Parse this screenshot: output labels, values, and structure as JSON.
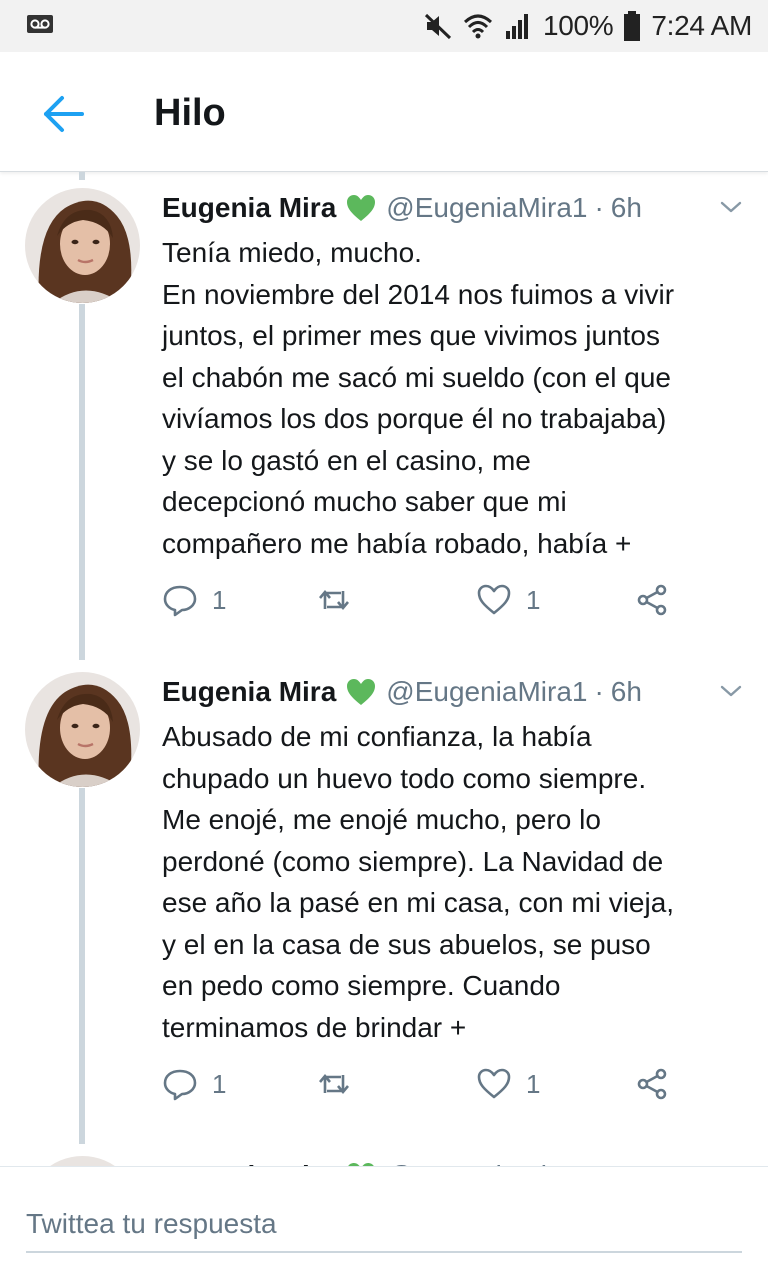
{
  "statusbar": {
    "battery": "100%",
    "time": "7:24 AM"
  },
  "header": {
    "title": "Hilo"
  },
  "tweets": [
    {
      "name": "Eugenia Mira",
      "handle": "@EugeniaMira1",
      "separator": "·",
      "time": "6h",
      "lines": [
        "Tenía miedo, mucho.",
        "En noviembre del 2014 nos fuimos a vivir",
        "juntos, el primer mes que vivimos juntos",
        "el chabón me sacó mi sueldo (con el que",
        "vivíamos los dos porque él no trabajaba)",
        "y se lo gastó en el casino, me",
        "decepcionó mucho saber que mi",
        "compañero me había robado, había +"
      ],
      "replies": "1",
      "likes": "1"
    },
    {
      "name": "Eugenia Mira",
      "handle": "@EugeniaMira1",
      "separator": "·",
      "time": "6h",
      "lines": [
        "Abusado de mi confianza, la había",
        "chupado un huevo todo como siempre.",
        "Me enojé, me enojé mucho, pero lo",
        "perdoné (como siempre). La Navidad de",
        "ese año la pasé en mi casa, con mi vieja,",
        "y el en la casa de sus abuelos, se puso",
        "en pedo como siempre. Cuando",
        "terminamos de brindar +"
      ],
      "replies": "1",
      "likes": "1"
    }
  ],
  "reply": {
    "placeholder": "Twittea tu respuesta"
  },
  "colors": {
    "accent": "#1da1f2",
    "secondary_text": "#657786",
    "thread_line": "#ccd6dd",
    "verified_heart": "#5cb85c"
  }
}
